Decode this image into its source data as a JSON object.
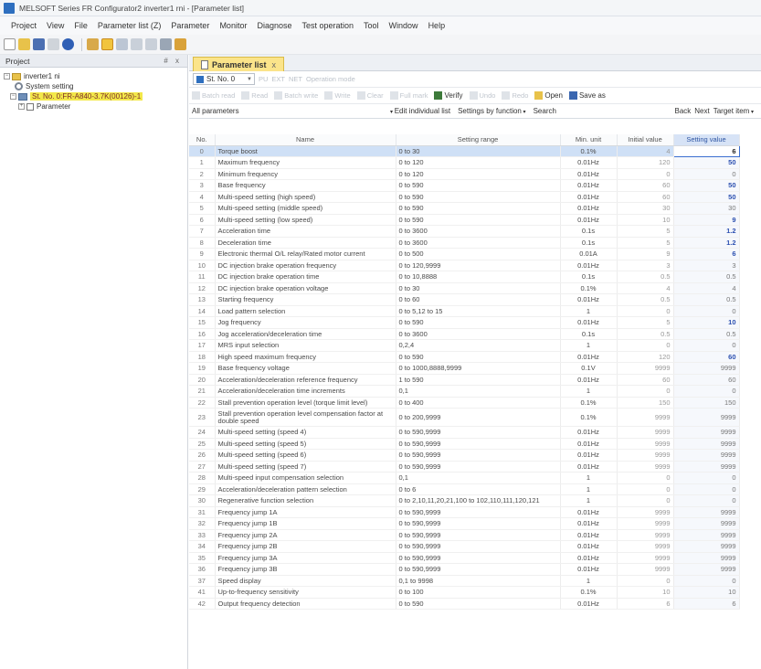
{
  "window": {
    "title": "MELSOFT Series FR Configurator2 inverter1 rni - [Parameter list]"
  },
  "menu": [
    "Project",
    "View",
    "File",
    "Parameter list (Z)",
    "Parameter",
    "Monitor",
    "Diagnose",
    "Test operation",
    "Tool",
    "Window",
    "Help"
  ],
  "project_panel": {
    "title": "Project",
    "pin": "# x",
    "tree": {
      "root": "inverter1 ni",
      "system": "System setting",
      "station": "St. No. 0:FR-A840-3.7K(00126)-1",
      "parameter": "Parameter"
    }
  },
  "tab": {
    "label": "Parameter list",
    "close": "x"
  },
  "station_selector": {
    "value": "St. No. 0"
  },
  "station_dim": [
    "PU",
    "EXT",
    "NET",
    "Operation mode"
  ],
  "ribbon": {
    "disabled": [
      "Batch read",
      "Read",
      "Batch write",
      "Write",
      "Clear",
      "Full mark"
    ],
    "verify": "Verify",
    "disabled2": [
      "Undo",
      "Redo"
    ],
    "open": "Open",
    "save_as": "Save as"
  },
  "filter": {
    "all_parameters": "All parameters",
    "edit_list": "Edit individual list",
    "by_function": "Settings by function",
    "search": "Search",
    "back": "Back",
    "next": "Next",
    "target": "Target item"
  },
  "columns": [
    "No.",
    "Name",
    "Setting range",
    "Min. unit",
    "Initial value",
    "Setting value"
  ],
  "rows": [
    {
      "no": "0",
      "name": "Torque boost",
      "range": "0 to 30",
      "unit": "0.1%",
      "init": "4",
      "set": "6",
      "bold": true,
      "sel": true
    },
    {
      "no": "1",
      "name": "Maximum frequency",
      "range": "0 to 120",
      "unit": "0.01Hz",
      "init": "120",
      "set": "50",
      "bold": true
    },
    {
      "no": "2",
      "name": "Minimum frequency",
      "range": "0 to 120",
      "unit": "0.01Hz",
      "init": "0",
      "set": "0"
    },
    {
      "no": "3",
      "name": "Base frequency",
      "range": "0 to 590",
      "unit": "0.01Hz",
      "init": "60",
      "set": "50",
      "bold": true
    },
    {
      "no": "4",
      "name": "Multi-speed setting (high speed)",
      "range": "0 to 590",
      "unit": "0.01Hz",
      "init": "60",
      "set": "50",
      "bold": true
    },
    {
      "no": "5",
      "name": "Multi-speed setting (middle speed)",
      "range": "0 to 590",
      "unit": "0.01Hz",
      "init": "30",
      "set": "30"
    },
    {
      "no": "6",
      "name": "Multi-speed setting (low speed)",
      "range": "0 to 590",
      "unit": "0.01Hz",
      "init": "10",
      "set": "9",
      "bold": true
    },
    {
      "no": "7",
      "name": "Acceleration time",
      "range": "0 to 3600",
      "unit": "0.1s",
      "init": "5",
      "set": "1.2",
      "bold": true
    },
    {
      "no": "8",
      "name": "Deceleration time",
      "range": "0 to 3600",
      "unit": "0.1s",
      "init": "5",
      "set": "1.2",
      "bold": true
    },
    {
      "no": "9",
      "name": "Electronic thermal O/L relay/Rated motor current",
      "range": "0 to 500",
      "unit": "0.01A",
      "init": "9",
      "set": "6",
      "bold": true
    },
    {
      "no": "10",
      "name": "DC injection brake operation frequency",
      "range": "0 to 120,9999",
      "unit": "0.01Hz",
      "init": "3",
      "set": "3"
    },
    {
      "no": "11",
      "name": "DC injection brake operation time",
      "range": "0 to 10,8888",
      "unit": "0.1s",
      "init": "0.5",
      "set": "0.5"
    },
    {
      "no": "12",
      "name": "DC injection brake operation voltage",
      "range": "0 to 30",
      "unit": "0.1%",
      "init": "4",
      "set": "4"
    },
    {
      "no": "13",
      "name": "Starting frequency",
      "range": "0 to 60",
      "unit": "0.01Hz",
      "init": "0.5",
      "set": "0.5"
    },
    {
      "no": "14",
      "name": "Load pattern selection",
      "range": "0 to 5,12 to 15",
      "unit": "1",
      "init": "0",
      "set": "0"
    },
    {
      "no": "15",
      "name": "Jog frequency",
      "range": "0 to 590",
      "unit": "0.01Hz",
      "init": "5",
      "set": "10",
      "bold": true
    },
    {
      "no": "16",
      "name": "Jog acceleration/deceleration time",
      "range": "0 to 3600",
      "unit": "0.1s",
      "init": "0.5",
      "set": "0.5"
    },
    {
      "no": "17",
      "name": "MRS input selection",
      "range": "0,2,4",
      "unit": "1",
      "init": "0",
      "set": "0"
    },
    {
      "no": "18",
      "name": "High speed maximum frequency",
      "range": "0 to 590",
      "unit": "0.01Hz",
      "init": "120",
      "set": "60",
      "bold": true
    },
    {
      "no": "19",
      "name": "Base frequency voltage",
      "range": "0 to 1000,8888,9999",
      "unit": "0.1V",
      "init": "9999",
      "set": "9999"
    },
    {
      "no": "20",
      "name": "Acceleration/deceleration reference frequency",
      "range": "1 to 590",
      "unit": "0.01Hz",
      "init": "60",
      "set": "60"
    },
    {
      "no": "21",
      "name": "Acceleration/deceleration time increments",
      "range": "0,1",
      "unit": "1",
      "init": "0",
      "set": "0"
    },
    {
      "no": "22",
      "name": "Stall prevention operation level (torque limit level)",
      "range": "0 to 400",
      "unit": "0.1%",
      "init": "150",
      "set": "150"
    },
    {
      "no": "23",
      "name": "Stall prevention operation level compensation factor at double speed",
      "range": "0 to 200,9999",
      "unit": "0.1%",
      "init": "9999",
      "set": "9999",
      "tall": true
    },
    {
      "no": "24",
      "name": "Multi-speed setting (speed 4)",
      "range": "0 to 590,9999",
      "unit": "0.01Hz",
      "init": "9999",
      "set": "9999"
    },
    {
      "no": "25",
      "name": "Multi-speed setting (speed 5)",
      "range": "0 to 590,9999",
      "unit": "0.01Hz",
      "init": "9999",
      "set": "9999"
    },
    {
      "no": "26",
      "name": "Multi-speed setting (speed 6)",
      "range": "0 to 590,9999",
      "unit": "0.01Hz",
      "init": "9999",
      "set": "9999"
    },
    {
      "no": "27",
      "name": "Multi-speed setting (speed 7)",
      "range": "0 to 590,9999",
      "unit": "0.01Hz",
      "init": "9999",
      "set": "9999"
    },
    {
      "no": "28",
      "name": "Multi-speed input compensation selection",
      "range": "0,1",
      "unit": "1",
      "init": "0",
      "set": "0"
    },
    {
      "no": "29",
      "name": "Acceleration/deceleration pattern selection",
      "range": "0 to 6",
      "unit": "1",
      "init": "0",
      "set": "0"
    },
    {
      "no": "30",
      "name": "Regenerative function selection",
      "range": "0 to 2,10,11,20,21,100 to 102,110,111,120,121",
      "unit": "1",
      "init": "0",
      "set": "0"
    },
    {
      "no": "31",
      "name": "Frequency jump 1A",
      "range": "0 to 590,9999",
      "unit": "0.01Hz",
      "init": "9999",
      "set": "9999"
    },
    {
      "no": "32",
      "name": "Frequency jump 1B",
      "range": "0 to 590,9999",
      "unit": "0.01Hz",
      "init": "9999",
      "set": "9999"
    },
    {
      "no": "33",
      "name": "Frequency jump 2A",
      "range": "0 to 590,9999",
      "unit": "0.01Hz",
      "init": "9999",
      "set": "9999"
    },
    {
      "no": "34",
      "name": "Frequency jump 2B",
      "range": "0 to 590,9999",
      "unit": "0.01Hz",
      "init": "9999",
      "set": "9999"
    },
    {
      "no": "35",
      "name": "Frequency jump 3A",
      "range": "0 to 590,9999",
      "unit": "0.01Hz",
      "init": "9999",
      "set": "9999"
    },
    {
      "no": "36",
      "name": "Frequency jump 3B",
      "range": "0 to 590,9999",
      "unit": "0.01Hz",
      "init": "9999",
      "set": "9999"
    },
    {
      "no": "37",
      "name": "Speed display",
      "range": "0,1 to 9998",
      "unit": "1",
      "init": "0",
      "set": "0"
    },
    {
      "no": "41",
      "name": "Up-to-frequency sensitivity",
      "range": "0 to 100",
      "unit": "0.1%",
      "init": "10",
      "set": "10"
    },
    {
      "no": "42",
      "name": "Output frequency detection",
      "range": "0 to 590",
      "unit": "0.01Hz",
      "init": "6",
      "set": "6"
    }
  ]
}
